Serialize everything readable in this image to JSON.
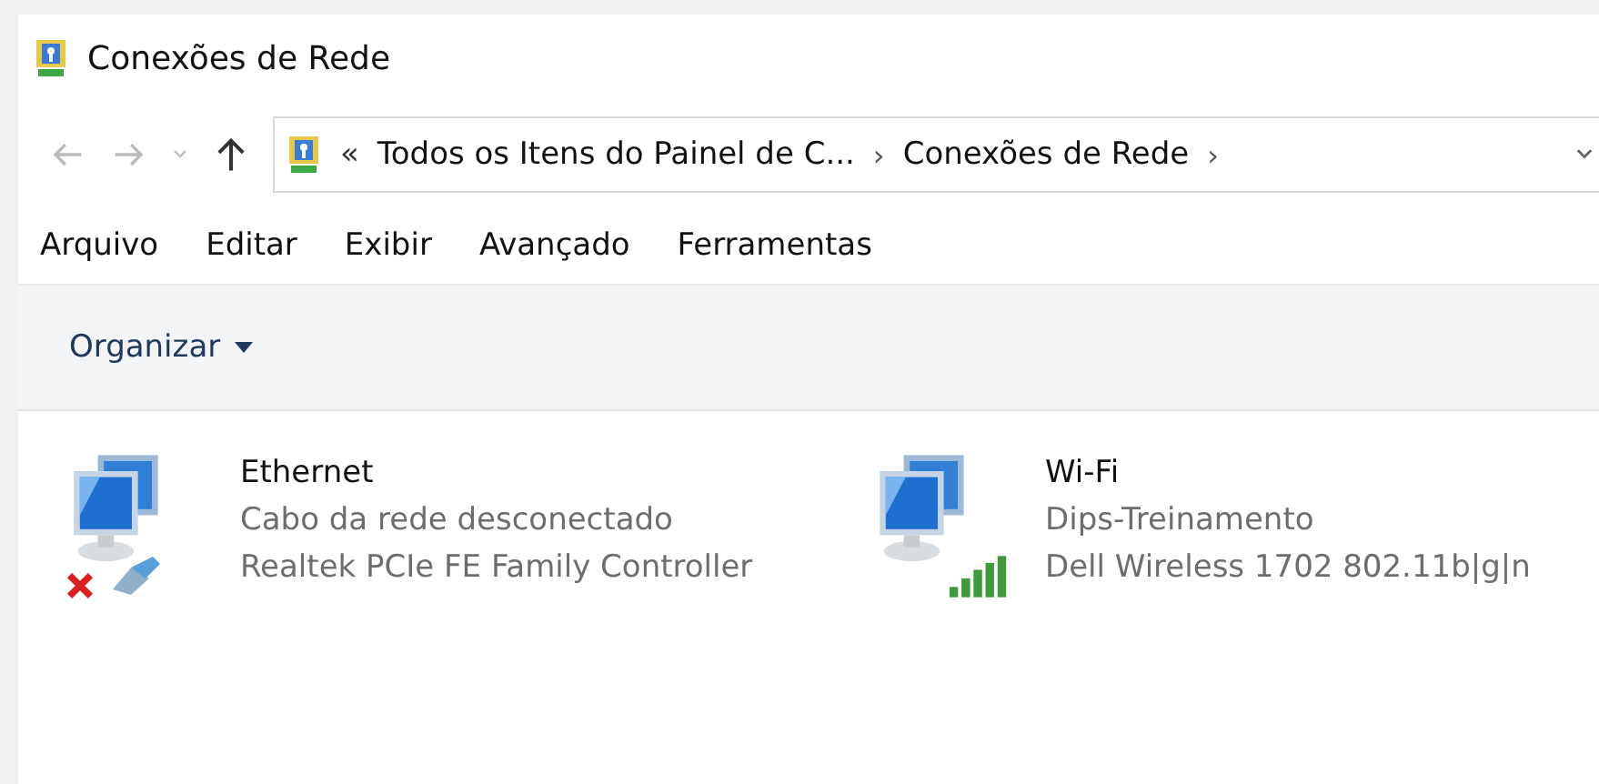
{
  "window": {
    "title": "Conexões de Rede"
  },
  "address_bar": {
    "overflow": "«",
    "crumbs": [
      "Todos os Itens do Painel de C...",
      "Conexões de Rede"
    ],
    "separator": "›"
  },
  "menu": [
    "Arquivo",
    "Editar",
    "Exibir",
    "Avançado",
    "Ferramentas"
  ],
  "toolbar": {
    "organize": "Organizar"
  },
  "adapters": [
    {
      "kind": "ethernet",
      "name": "Ethernet",
      "status": "Cabo da rede desconectado",
      "device": "Realtek PCIe FE Family Controller"
    },
    {
      "kind": "wifi",
      "name": "Wi-Fi",
      "status": "Dips-Treinamento",
      "device": "Dell Wireless 1702 802.11b|g|n"
    }
  ]
}
